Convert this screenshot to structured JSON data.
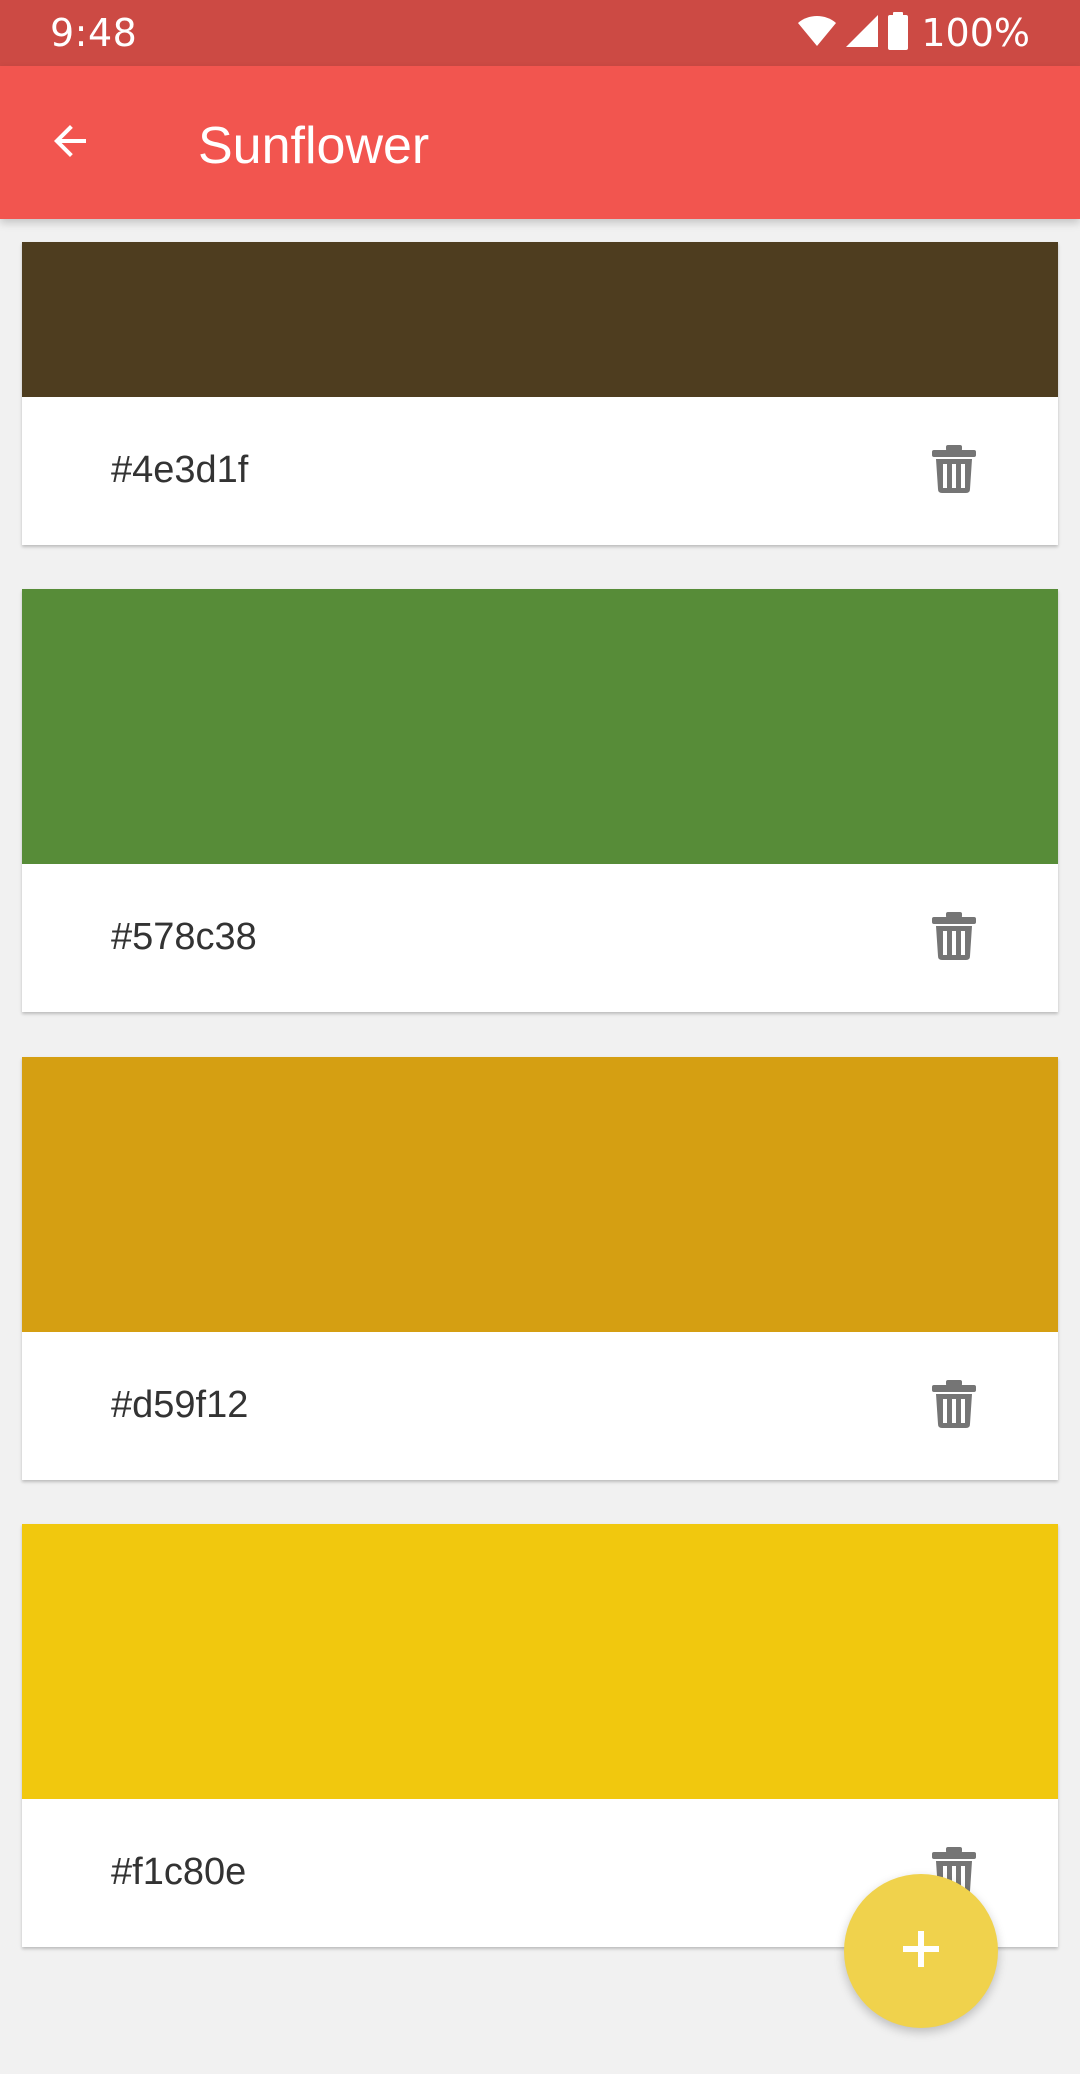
{
  "status_bar": {
    "time": "9:48",
    "battery_percent": "100%",
    "icons": [
      "wifi-icon",
      "cell-signal-icon",
      "battery-icon"
    ]
  },
  "app_bar": {
    "title": "Sunflower",
    "back_icon": "arrow-back-icon",
    "color": "#f2554f"
  },
  "colors": [
    {
      "hex": "#4e3d1f",
      "swatch": "#4e3d1f"
    },
    {
      "hex": "#578c38",
      "swatch": "#578c38"
    },
    {
      "hex": "#d59f12",
      "swatch": "#d59f12"
    },
    {
      "hex": "#f1c80e",
      "swatch": "#f1c80e"
    }
  ],
  "actions": {
    "delete_icon": "trash-icon",
    "add_icon": "plus-icon",
    "fab_color": "#f0d24c"
  }
}
